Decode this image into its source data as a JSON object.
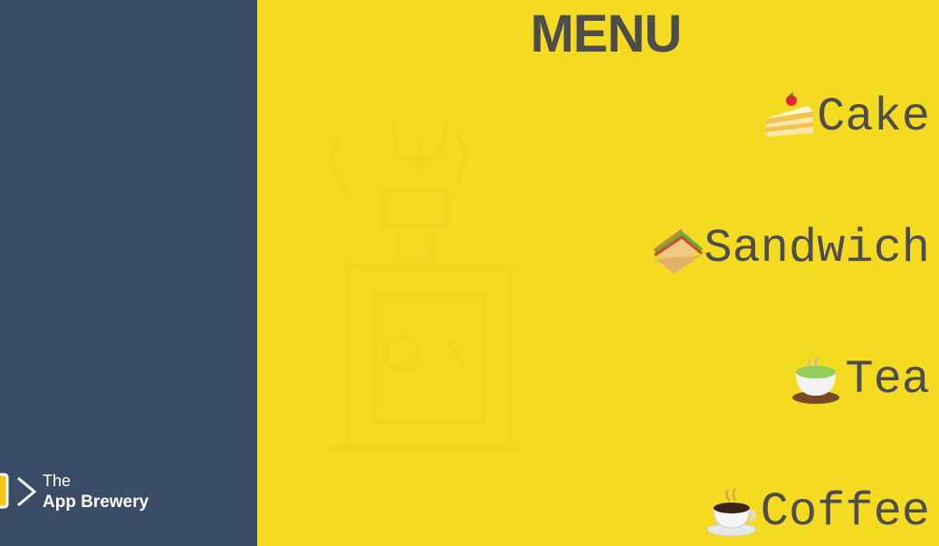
{
  "brand": {
    "line1": "The",
    "line2": "App Brewery"
  },
  "menu": {
    "title": "MENU",
    "items": [
      {
        "emoji": "cake-icon",
        "label": "Cake"
      },
      {
        "emoji": "sandwich-icon",
        "label": "Sandwich"
      },
      {
        "emoji": "tea-icon",
        "label": "Tea"
      },
      {
        "emoji": "coffee-icon",
        "label": "Coffee"
      }
    ]
  },
  "colors": {
    "sidebar": "#3b4d66",
    "background": "#f5da22",
    "text": "#4d4d4d"
  }
}
